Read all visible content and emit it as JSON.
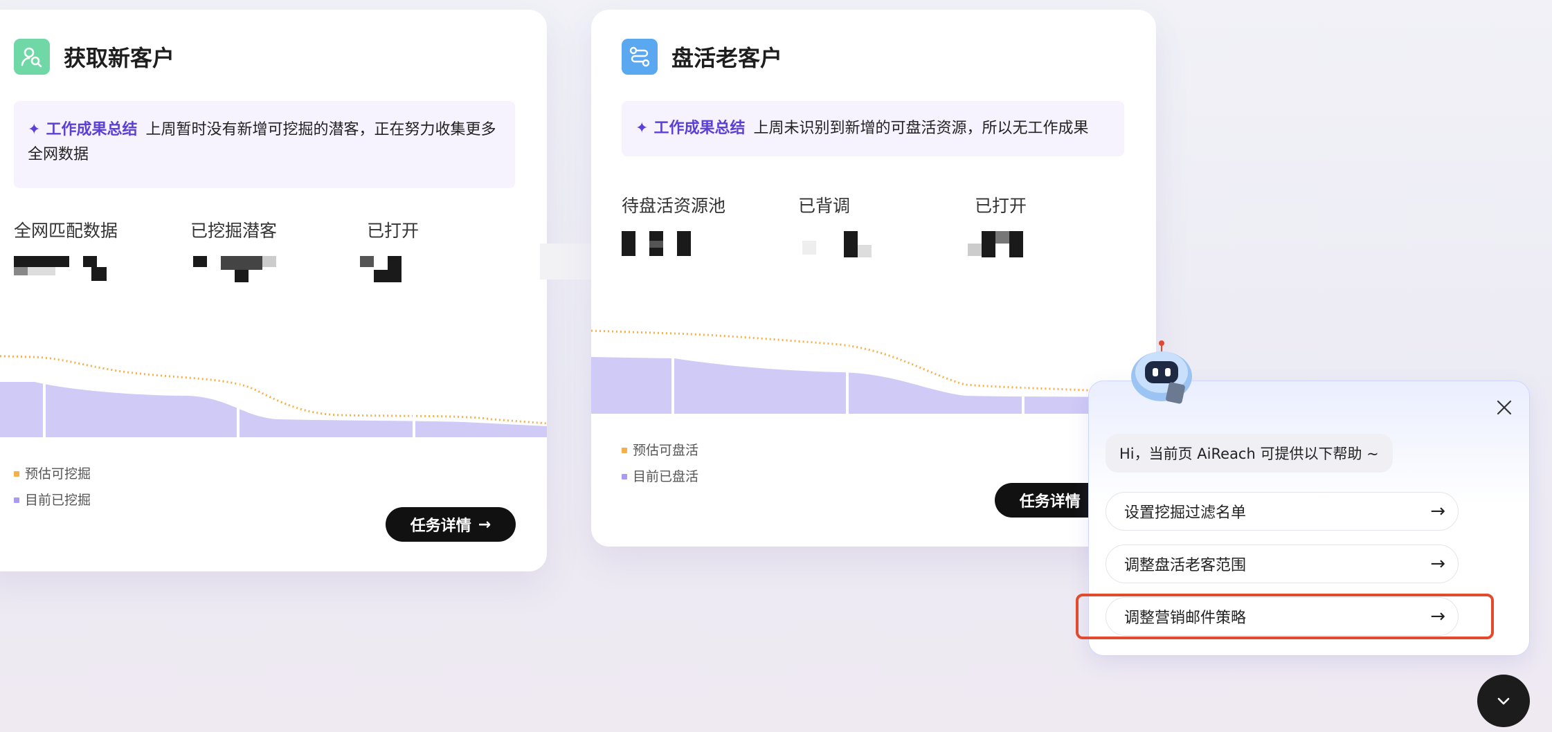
{
  "colors": {
    "accent_purple": "#5b3fd6",
    "estimate_orange": "#f4b04a",
    "actual_purple": "#a79cf0",
    "highlight_red": "#e24a2e"
  },
  "card_acquire": {
    "icon": "user-search-icon",
    "title": "获取新客户",
    "summary_label": "工作成果总结",
    "summary_text": "上周暂时没有新增可挖掘的潜客，正在努力收集更多全网数据",
    "metrics": [
      {
        "label": "全网匹配数据"
      },
      {
        "label": "已挖掘潜客"
      },
      {
        "label": "已打开"
      }
    ],
    "legend": [
      "预估可挖掘",
      "目前已挖掘"
    ],
    "button_label": "任务详情"
  },
  "card_revive": {
    "icon": "route-icon",
    "title": "盘活老客户",
    "summary_label": "工作成果总结",
    "summary_text": "上周未识别到新增的可盘活资源，所以无工作成果",
    "metrics": [
      {
        "label": "待盘活资源池"
      },
      {
        "label": "已背调"
      },
      {
        "label": "已打开"
      }
    ],
    "legend": [
      "预估可盘活",
      "目前已盘活"
    ],
    "button_label": "任务详情"
  },
  "assistant": {
    "greeting": "Hi，当前页 AiReach 可提供以下帮助 ~",
    "options": [
      "设置挖掘过滤名单",
      "调整盘活老客范围",
      "调整营销邮件策略"
    ],
    "highlighted_option": "调整营销邮件策略"
  }
}
